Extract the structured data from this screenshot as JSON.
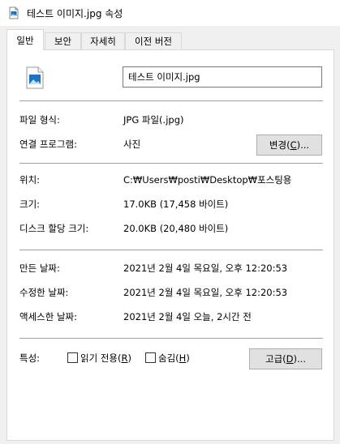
{
  "window": {
    "title": "테스트 이미지.jpg 속성"
  },
  "tabs": [
    {
      "label": "일반",
      "active": true
    },
    {
      "label": "보안"
    },
    {
      "label": "자세히"
    },
    {
      "label": "이전 버전"
    }
  ],
  "general": {
    "file_name": "테스트 이미지.jpg",
    "file_type_label": "파일 형식:",
    "file_type_value": "JPG 파일(.jpg)",
    "opens_with_label": "연결 프로그램:",
    "opens_with_value": "사진",
    "change_button": {
      "text": "변경(",
      "accel": "C",
      "suffix": ")..."
    },
    "location_label": "위치:",
    "location_value": "C:₩Users₩posti₩Desktop₩포스팅용",
    "size_label": "크기:",
    "size_value": "17.0KB (17,458 바이트)",
    "size_on_disk_label": "디스크 할당 크기:",
    "size_on_disk_value": "20.0KB (20,480 바이트)",
    "created_label": "만든 날짜:",
    "created_value": "2021년 2월 4일 목요일, 오후 12:20:53",
    "modified_label": "수정한 날짜:",
    "modified_value": "2021년 2월 4일 목요일, 오후 12:20:53",
    "accessed_label": "액세스한 날짜:",
    "accessed_value": "2021년 2월 4일 오늘, 2시간 전",
    "attributes_label": "특성:",
    "readonly": {
      "text": "읽기 전용(",
      "accel": "R",
      "suffix": ")",
      "checked": false
    },
    "hidden": {
      "text": "숨김(",
      "accel": "H",
      "suffix": ")",
      "checked": false
    },
    "advanced_button": {
      "text": "고급(",
      "accel": "D",
      "suffix": ")..."
    }
  },
  "colors": {
    "panel_bg": "#ffffff",
    "dialog_bg": "#f0f0f0",
    "button_bg": "#e1e1e1",
    "image_icon_blue": "#1e73be"
  },
  "icons": {
    "title": "image-file-icon",
    "file": "image-file-icon"
  }
}
